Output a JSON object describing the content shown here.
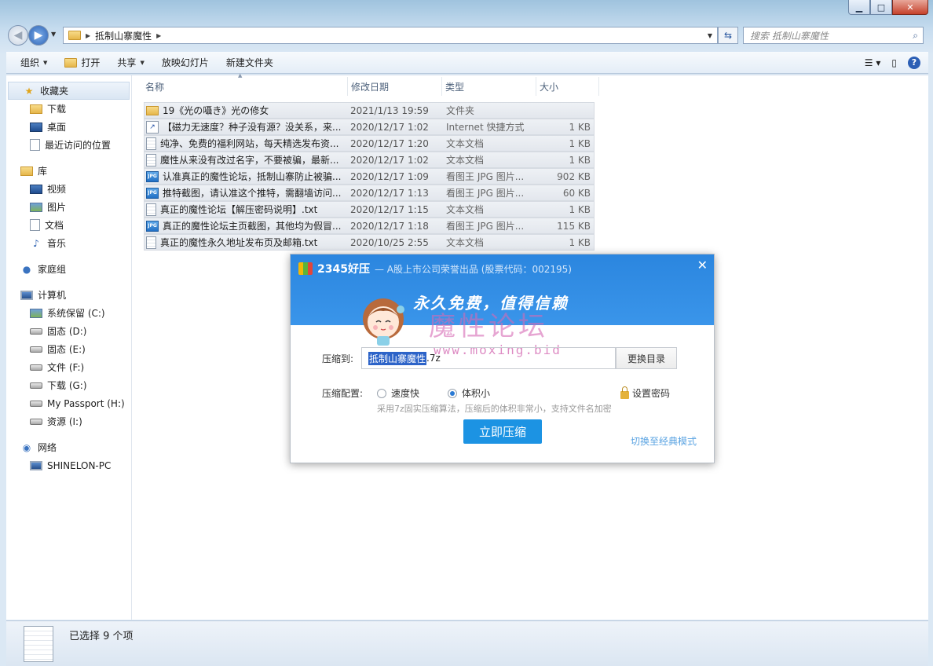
{
  "window": {
    "minimize_glyph": "▁",
    "maximize_glyph": "□",
    "close_glyph": "✕"
  },
  "address": {
    "path": "抵制山寨魔性",
    "search_placeholder": "搜索 抵制山寨魔性"
  },
  "toolbar": {
    "organize": "组织",
    "open": "打开",
    "share": "共享",
    "slideshow": "放映幻灯片",
    "new_folder": "新建文件夹"
  },
  "sidebar": {
    "favorites": "收藏夹",
    "fav_items": [
      "下载",
      "桌面",
      "最近访问的位置"
    ],
    "libraries": "库",
    "lib_items": [
      "视频",
      "图片",
      "文档",
      "音乐"
    ],
    "homegroup": "家庭组",
    "computer": "计算机",
    "drives": [
      "系统保留 (C:)",
      "固态 (D:)",
      "固态 (E:)",
      "文件 (F:)",
      "下载 (G:)",
      "My Passport (H:)",
      "资源 (I:)"
    ],
    "network": "网络",
    "net_items": [
      "SHINELON-PC"
    ]
  },
  "columns": {
    "name": "名称",
    "date": "修改日期",
    "type": "类型",
    "size": "大小"
  },
  "files": [
    {
      "name": "19《光の囁き》光の修女",
      "date": "2021/1/13 19:59",
      "type": "文件夹",
      "size": "",
      "icon": "folder"
    },
    {
      "name": "【磁力无速度？种子没有源？没关系，来...",
      "date": "2020/12/17 1:02",
      "type": "Internet 快捷方式",
      "size": "1 KB",
      "icon": "url"
    },
    {
      "name": "纯净、免费的福利网站，每天精选发布资...",
      "date": "2020/12/17 1:20",
      "type": "文本文档",
      "size": "1 KB",
      "icon": "txt"
    },
    {
      "name": "魔性从来没有改过名字，不要被骗，最新...",
      "date": "2020/12/17 1:02",
      "type": "文本文档",
      "size": "1 KB",
      "icon": "txt"
    },
    {
      "name": "认准真正的魔性论坛，抵制山寨防止被骗...",
      "date": "2020/12/17 1:09",
      "type": "看图王 JPG 图片...",
      "size": "902 KB",
      "icon": "jpg"
    },
    {
      "name": "推特截图，请认准这个推特，需翻墙访问...",
      "date": "2020/12/17 1:13",
      "type": "看图王 JPG 图片...",
      "size": "60 KB",
      "icon": "jpg"
    },
    {
      "name": "真正的魔性论坛【解压密码说明】.txt",
      "date": "2020/12/17 1:15",
      "type": "文本文档",
      "size": "1 KB",
      "icon": "txt"
    },
    {
      "name": "真正的魔性论坛主页截图，其他均为假冒...",
      "date": "2020/12/17 1:18",
      "type": "看图王 JPG 图片...",
      "size": "115 KB",
      "icon": "jpg"
    },
    {
      "name": "真正的魔性永久地址发布页及邮箱.txt",
      "date": "2020/10/25 2:55",
      "type": "文本文档",
      "size": "1 KB",
      "icon": "txt"
    }
  ],
  "status": {
    "selected": "已选择 9 个项"
  },
  "dialog": {
    "brand": "2345好压",
    "subtitle": "— A股上市公司荣誉出品 (股票代码：002195)",
    "slogan": "永久免费，值得信赖",
    "watermark_cn": "魔性论坛",
    "watermark_url": "www.moxing.bid",
    "compress_to_label": "压缩到:",
    "path_selected": "抵制山寨魔性",
    "path_suffix": ".7z",
    "change_dir": "更换目录",
    "config_label": "压缩配置:",
    "opt_fast": "速度快",
    "opt_small": "体积小",
    "selected_option": "opt_small",
    "set_password": "设置密码",
    "hint": "采用7z固实压缩算法，压缩后的体积非常小，支持文件名加密",
    "compress_now": "立即压缩",
    "classic_mode": "切换至经典模式",
    "accent": "#1c93e3"
  }
}
